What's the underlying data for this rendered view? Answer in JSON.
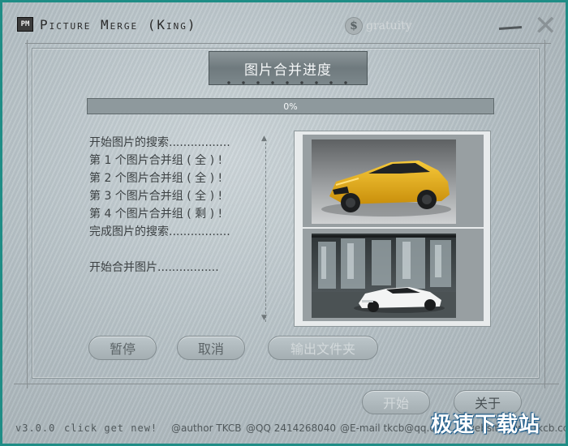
{
  "window": {
    "app_icon_text": "PM",
    "title": "Picture Merge (King)",
    "gratuity_symbol": "$",
    "gratuity_label": "gratuity",
    "minimize_glyph": "—",
    "close_glyph": "✕"
  },
  "header": {
    "title": "图片合并进度"
  },
  "progress": {
    "value": 0,
    "label": "0%"
  },
  "log": {
    "lines": [
      "开始图片的搜索.................",
      "第 1 个图片合并组 ( 全 ) !",
      "第 2 个图片合并组 ( 全 ) !",
      "第 3 个图片合并组 ( 全 ) !",
      "第 4 个图片合并组 ( 剩 ) !",
      "完成图片的搜索.................",
      "",
      "开始合并图片................."
    ]
  },
  "buttons": {
    "pause": "暂停",
    "cancel": "取消",
    "output_folder": "输出文件夹",
    "start": "开始",
    "about": "关于"
  },
  "footer": {
    "version": "v3.0.0",
    "click_new": "click get new!",
    "author": "@author TKCB",
    "qq": "@QQ 2414268040",
    "email": "@E-mail tkcb@qq.com",
    "website": "@website www.tkcb.cc"
  },
  "watermark": "极速下载站",
  "colors": {
    "window_border": "#1f8d86",
    "progress_track": "#8e999d",
    "progress_fill": "#4e575a",
    "car_top": "#e7b11b",
    "car_bottom": "#f2f2f2"
  }
}
